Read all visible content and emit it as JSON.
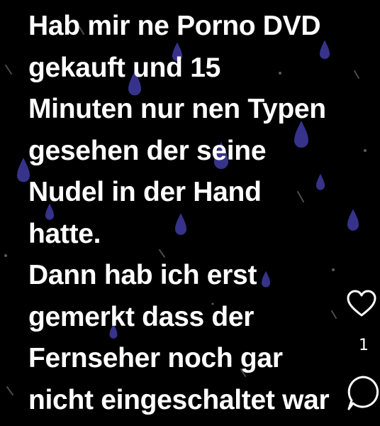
{
  "post": {
    "lines": [
      "Hab mir ne Porno DVD",
      "gekauft und 15",
      "Minuten nur nen Typen",
      "gesehen der seine",
      "Nudel in der Hand",
      "hatte.",
      "Dann hab ich erst",
      "gemerkt dass der",
      "Fernseher noch gar",
      "nicht eingeschaltet war"
    ]
  },
  "actions": {
    "like_icon": "heart-outline-icon",
    "like_count": "1",
    "comment_icon": "comment-bubble-icon"
  },
  "colors": {
    "background": "#000000",
    "text": "#ffffff",
    "drops": "#5a54c8"
  }
}
